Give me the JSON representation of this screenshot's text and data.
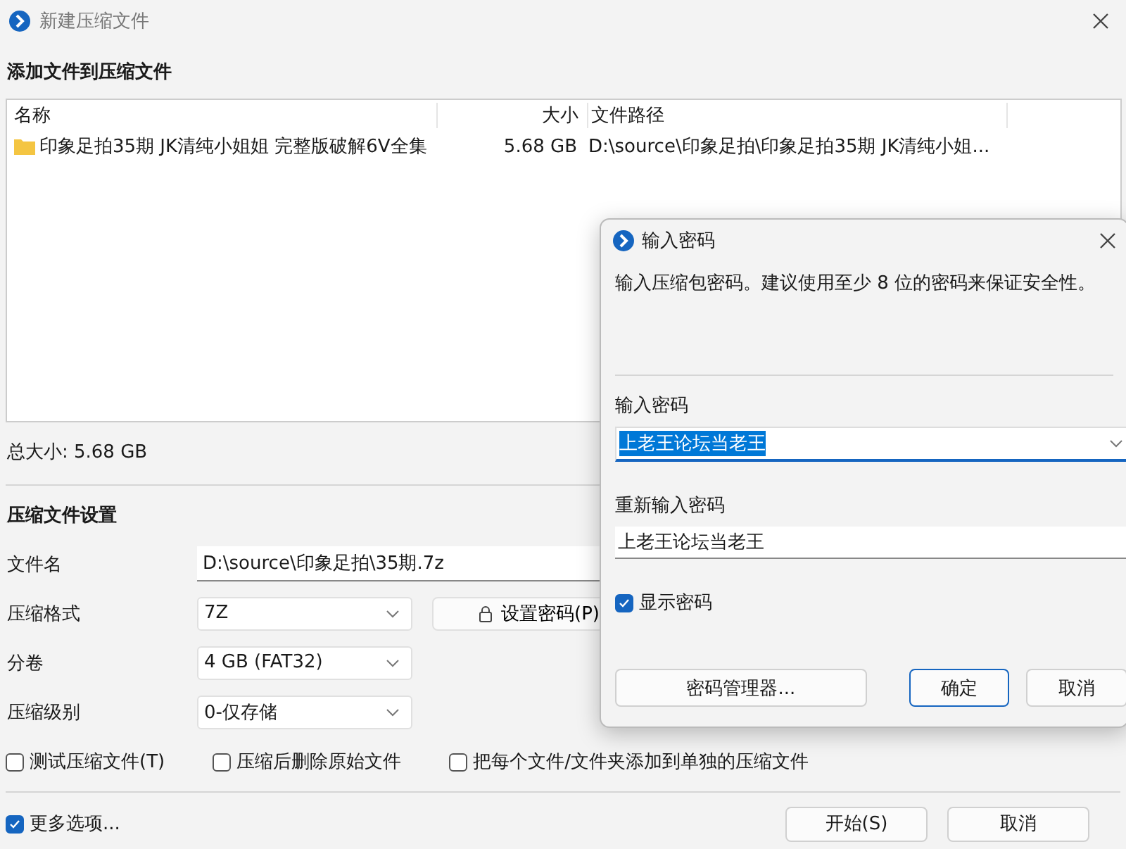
{
  "window": {
    "title": "新建压缩文件"
  },
  "heading": "添加文件到压缩文件",
  "file_list": {
    "columns": [
      "名称",
      "大小",
      "文件路径"
    ],
    "rows": [
      {
        "name": "印象足拍35期 JK清纯小姐姐 完整版破解6V全集",
        "size": "5.68 GB",
        "path": "D:\\source\\印象足拍\\印象足拍35期 JK清纯小姐..."
      }
    ]
  },
  "total_size": "总大小: 5.68 GB",
  "settings": {
    "heading": "压缩文件设置",
    "filename": {
      "label": "文件名",
      "value": "D:\\source\\印象足拍\\35期.7z"
    },
    "format": {
      "label": "压缩格式",
      "value": "7Z"
    },
    "set_password_button": "设置密码(P)",
    "volume": {
      "label": "分卷",
      "value": "4 GB (FAT32)"
    },
    "level": {
      "label": "压缩级别",
      "value": "0-仅存储"
    },
    "checkboxes": [
      {
        "label": "测试压缩文件(T)",
        "checked": false
      },
      {
        "label": "压缩后删除原始文件",
        "checked": false
      },
      {
        "label": "把每个文件/文件夹添加到单独的压缩文件",
        "checked": false
      }
    ]
  },
  "more_options": {
    "label": "更多选项...",
    "checked": true
  },
  "buttons": [
    "开始(S)",
    "取消"
  ],
  "dialog": {
    "title": "输入密码",
    "description": "输入压缩包密码。建议使用至少 8 位的密码来保证安全性。",
    "password": {
      "label": "输入密码",
      "value": "上老王论坛当老王",
      "selected": true
    },
    "confirm": {
      "label": "重新输入密码",
      "value": "上老王论坛当老王",
      "selected": false
    },
    "show_password": {
      "label": "显示密码",
      "checked": true
    },
    "buttons": [
      {
        "label": "密码管理器...",
        "default": false
      },
      {
        "label": "确定",
        "default": true
      },
      {
        "label": "取消",
        "default": false
      }
    ]
  }
}
